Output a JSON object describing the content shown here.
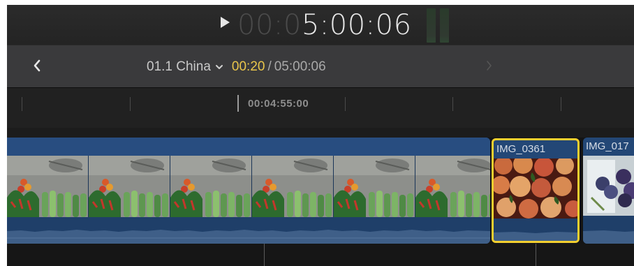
{
  "viewer": {
    "timecode": {
      "dim": "00:0",
      "bright": "5:00:06"
    }
  },
  "navigation": {
    "project_name": "01.1 China",
    "playhead_time": "00:20",
    "separator": "/",
    "duration": "05:00:06"
  },
  "ruler": {
    "label": "00:04:55:00"
  },
  "clips": [
    {
      "name": "IMG_0361",
      "selected": true
    },
    {
      "name": "IMG_017",
      "selected": false
    }
  ],
  "colors": {
    "accent_yellow": "#f2cf2f",
    "clip_blue": "#234776",
    "timeline_bg": "#171717"
  },
  "icons": {
    "play": "play-icon",
    "back": "chevron-left-icon",
    "forward": "chevron-right-icon",
    "project_menu": "chevron-down-icon"
  }
}
